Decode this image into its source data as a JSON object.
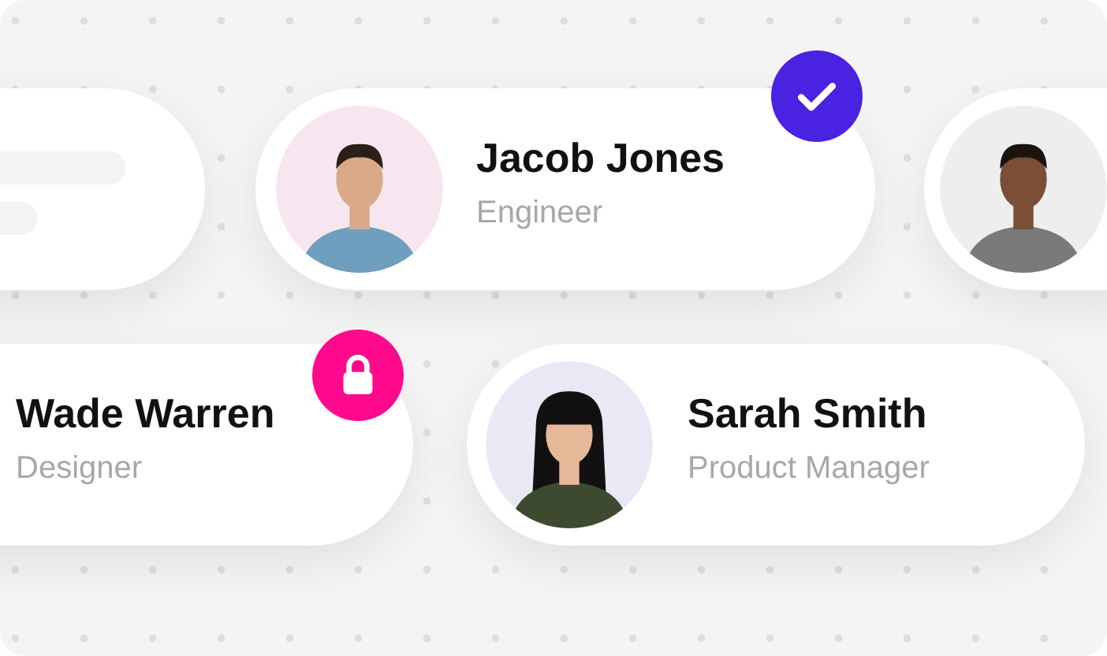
{
  "cards": [
    {
      "kind": "placeholder"
    },
    {
      "kind": "person",
      "name": "Jacob Jones",
      "role": "Engineer",
      "color": "#f7e6f0",
      "verified": true
    },
    {
      "kind": "person",
      "color": "#eeeeee"
    },
    {
      "kind": "person",
      "name": "Wade Warren",
      "role": "Designer",
      "locked": true
    },
    {
      "kind": "person",
      "name": "Sarah Smith",
      "role": "Product Manager",
      "color": "#ebe8f6"
    }
  ]
}
